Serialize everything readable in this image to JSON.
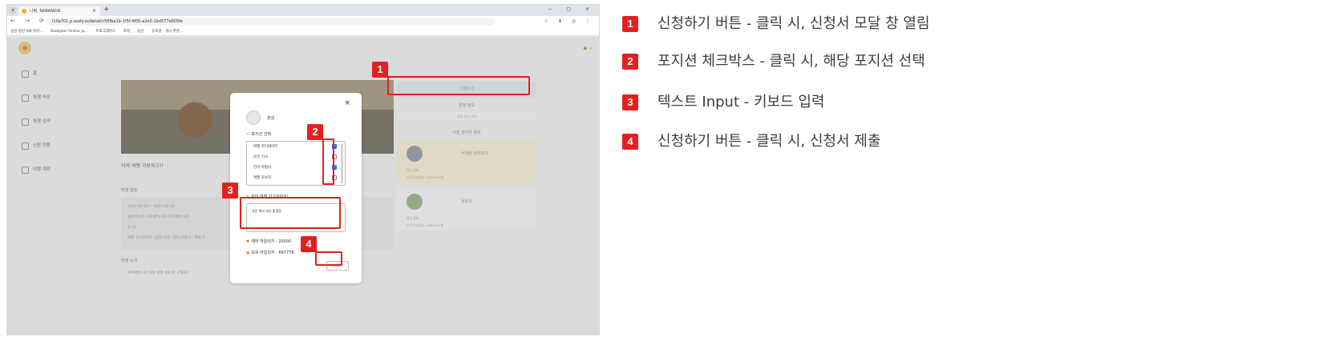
{
  "browser": {
    "tab_title": "나랑, NARANG로",
    "url": "i10a701.p.ssafy.io/detail/c50fba1b-1f5f-4f05-a2e0-1bd577e605fe",
    "bookmarks": [
      "삼성 청년 SW 아카...",
      "Baekjoon Online Ju...",
      "프로그래머스",
      "코테",
      "동산",
      "유포형 - 개시 추천..."
    ]
  },
  "app": {
    "sidebar": [
      "홈",
      "동행 작성",
      "동행 검색",
      "신청 현황",
      "여행 계획"
    ],
    "trip_title": "이색 여행 가보자고!!",
    "schedule_label": "여행 일정",
    "schedule_lines": [
      "2024-02-19 ~ 2024-02-22",
      "중앙아시아, 우즈베키스탄, 우즈베키스탄",
      "2 / 6",
      "여행 코디네이터 · 운전 기사 · 언어 마법사 · 여행 초"
    ],
    "intro_label": "여행 소개",
    "intro_text": "우즈베키스탄 이색 여행 바로 갈 구해요!!",
    "apply_button": "신청하기",
    "info_label": "일정 정보",
    "info_sub": "일정 정보 보기",
    "members_label": "여행 참여자 정보",
    "member1": {
      "name": "닉네임 넣어요다",
      "meta": [
        "성장 정보",
        "소유 마일리지: 2574000 원"
      ]
    },
    "member2": {
      "name": "동원조",
      "meta": [
        "성장 정보",
        "소유 마일리지: 2680000 원"
      ]
    }
  },
  "modal": {
    "close": "×",
    "name": "본심",
    "position_label": "포지션 선택",
    "positions": [
      {
        "label": "여행 코디네이터",
        "checked": true
      },
      {
        "label": "운전 기사",
        "checked": false
      },
      {
        "label": "언어 마법사",
        "checked": true
      },
      {
        "label": "여행 초보자",
        "checked": false
      }
    ],
    "question": "같이 여행 가고싶어요!",
    "text_value": "사진 찍사 대신 맡겠음",
    "mileage": "예약 마일리지 : 20000",
    "owned": "보유 마일리지 : 667778",
    "submit": "신청하기"
  },
  "badges": [
    "1",
    "2",
    "3",
    "4"
  ],
  "legend": [
    {
      "num": "1",
      "text": "신청하기 버튼 - 클릭 시, 신청서 모달 창 열림"
    },
    {
      "num": "2",
      "text": "포지션 체크박스 - 클릭 시, 해당 포지션 선택"
    },
    {
      "num": "3",
      "text": "텍스트 Input - 키보드 입력"
    },
    {
      "num": "4",
      "text": "신청하기 버튼 - 클릭 시, 신청서 제출"
    }
  ],
  "colors": {
    "badge": "#e41f1f",
    "checkbox": "#1a73e8"
  }
}
